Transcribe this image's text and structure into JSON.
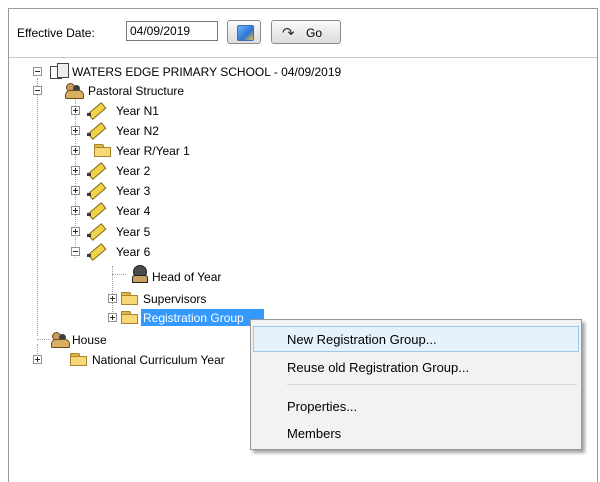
{
  "toolbar": {
    "effective_date_label": "Effective Date:",
    "effective_date_value": "04/09/2019",
    "go_label": "Go"
  },
  "tree": {
    "root": "WATERS EDGE PRIMARY SCHOOL - 04/09/2019",
    "pastoral": "Pastoral Structure",
    "years": [
      "Year N1",
      "Year  N2",
      "Year  R/Year  1",
      "Year  2",
      "Year  3",
      "Year  4",
      "Year  5",
      "Year  6"
    ],
    "head_of_year": "Head of Year",
    "supervisors": "Supervisors",
    "registration_group": "Registration Group",
    "house": "House",
    "national_curriculum": "National Curriculum Year"
  },
  "context_menu": {
    "items": [
      "New Registration Group...",
      "Reuse old Registration Group...",
      "Properties...",
      "Members"
    ]
  }
}
